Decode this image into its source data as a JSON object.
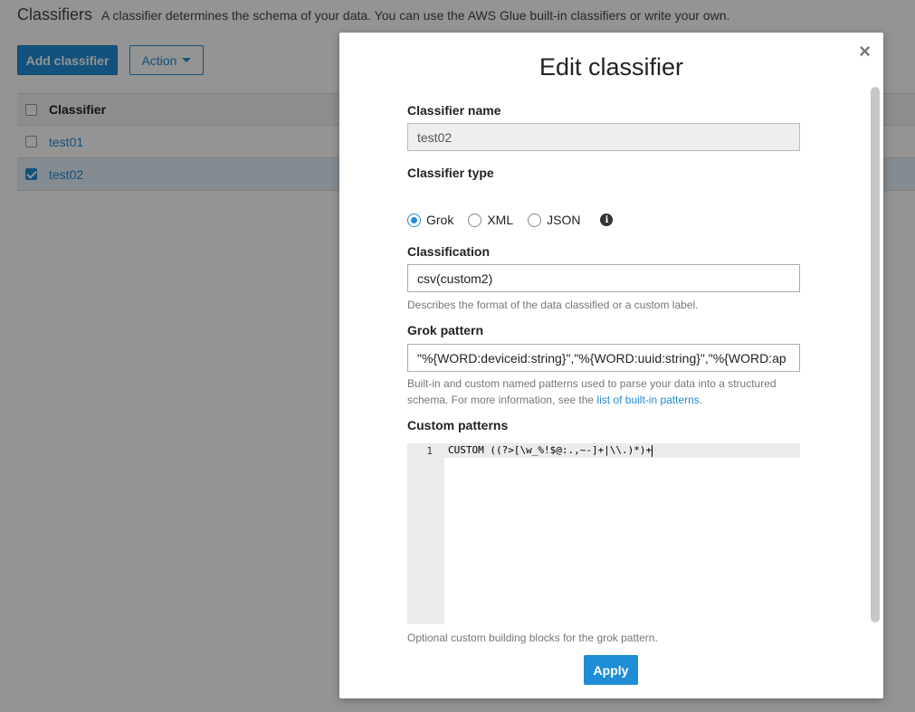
{
  "page": {
    "title": "Classifiers",
    "description": "A classifier determines the schema of your data. You can use the AWS Glue built-in classifiers or write your own.",
    "add_button": "Add classifier",
    "action_button": "Action",
    "table": {
      "header": "Classifier",
      "rows": [
        {
          "name": "test01",
          "checked": false
        },
        {
          "name": "test02",
          "checked": true
        }
      ]
    }
  },
  "modal": {
    "title": "Edit classifier",
    "close_icon": "close-icon",
    "name_label": "Classifier name",
    "name_value": "test02",
    "type_label": "Classifier type",
    "types": [
      "Grok",
      "XML",
      "JSON"
    ],
    "selected_type": "Grok",
    "classification_label": "Classification",
    "classification_value": "csv(custom2)",
    "classification_help": "Describes the format of the data classified or a custom label.",
    "grok_label": "Grok pattern",
    "grok_value": "\"%{WORD:deviceid:string}\",\"%{WORD:uuid:string}\",\"%{WORD:ap",
    "grok_help_prefix": "Built-in and custom named patterns used to parse your data into a structured schema. For more information, see the ",
    "grok_help_link": "list of built-in patterns",
    "grok_help_suffix": ".",
    "custom_label": "Custom patterns",
    "custom_line_number": "1",
    "custom_code": "CUSTOM ((?>[\\w_%!$@:.,~-]+|\\\\.)*)+",
    "custom_help": "Optional custom building blocks for the grok pattern.",
    "apply_button": "Apply"
  }
}
